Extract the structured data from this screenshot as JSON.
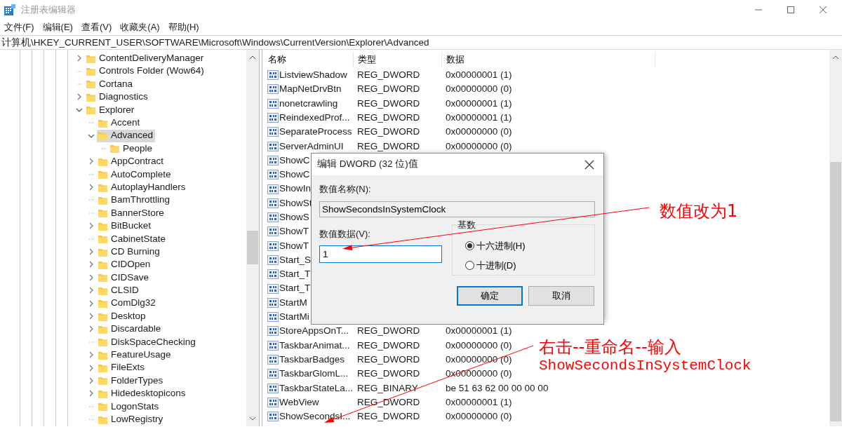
{
  "window": {
    "title": "注册表编辑器"
  },
  "menu": [
    "文件(F)",
    "编辑(E)",
    "查看(V)",
    "收藏夹(A)",
    "帮助(H)"
  ],
  "address": "计算机\\HKEY_CURRENT_USER\\SOFTWARE\\Microsoft\\Windows\\CurrentVersion\\Explorer\\Advanced",
  "tree": {
    "items": [
      {
        "label": "ContentDeliveryManager",
        "kind": "collapsed",
        "selected": false
      },
      {
        "label": "Controls Folder (Wow64)",
        "kind": "leaf",
        "selected": false
      },
      {
        "label": "Cortana",
        "kind": "leaf",
        "selected": false
      },
      {
        "label": "Diagnostics",
        "kind": "collapsed",
        "selected": false
      },
      {
        "label": "Explorer",
        "kind": "expanded",
        "selected": false,
        "children": [
          {
            "label": "Accent",
            "kind": "leaf",
            "selected": false
          },
          {
            "label": "Advanced",
            "kind": "expanded",
            "selected": true,
            "children": [
              {
                "label": "People",
                "kind": "leaf",
                "selected": false
              }
            ]
          },
          {
            "label": "AppContract",
            "kind": "collapsed",
            "selected": false
          },
          {
            "label": "AutoComplete",
            "kind": "leaf",
            "selected": false
          },
          {
            "label": "AutoplayHandlers",
            "kind": "collapsed",
            "selected": false
          },
          {
            "label": "BamThrottling",
            "kind": "leaf",
            "selected": false
          },
          {
            "label": "BannerStore",
            "kind": "leaf",
            "selected": false
          },
          {
            "label": "BitBucket",
            "kind": "collapsed",
            "selected": false
          },
          {
            "label": "CabinetState",
            "kind": "leaf",
            "selected": false
          },
          {
            "label": "CD Burning",
            "kind": "collapsed",
            "selected": false
          },
          {
            "label": "CIDOpen",
            "kind": "collapsed",
            "selected": false
          },
          {
            "label": "CIDSave",
            "kind": "collapsed",
            "selected": false
          },
          {
            "label": "CLSID",
            "kind": "collapsed",
            "selected": false
          },
          {
            "label": "ComDlg32",
            "kind": "collapsed",
            "selected": false
          },
          {
            "label": "Desktop",
            "kind": "collapsed",
            "selected": false
          },
          {
            "label": "Discardable",
            "kind": "collapsed",
            "selected": false
          },
          {
            "label": "DiskSpaceChecking",
            "kind": "leaf",
            "selected": false
          },
          {
            "label": "FeatureUsage",
            "kind": "collapsed",
            "selected": false
          },
          {
            "label": "FileExts",
            "kind": "collapsed",
            "selected": false
          },
          {
            "label": "FolderTypes",
            "kind": "collapsed",
            "selected": false
          },
          {
            "label": "Hidedesktopicons",
            "kind": "collapsed",
            "selected": false
          },
          {
            "label": "LogonStats",
            "kind": "leaf",
            "selected": false
          },
          {
            "label": "LowRegistry",
            "kind": "leaf",
            "selected": false
          }
        ]
      }
    ]
  },
  "values": {
    "columns": [
      "名称",
      "类型",
      "数据"
    ],
    "rows": [
      {
        "name": "ListviewShadow",
        "type": "REG_DWORD",
        "data": "0x00000001 (1)"
      },
      {
        "name": "MapNetDrvBtn",
        "type": "REG_DWORD",
        "data": "0x00000000 (0)"
      },
      {
        "name": "nonetcrawling",
        "type": "REG_DWORD",
        "data": "0x00000001 (1)"
      },
      {
        "name": "ReindexedProf...",
        "type": "REG_DWORD",
        "data": "0x00000001 (1)"
      },
      {
        "name": "SeparateProcess",
        "type": "REG_DWORD",
        "data": "0x00000000 (0)"
      },
      {
        "name": "ServerAdminUI",
        "type": "REG_DWORD",
        "data": "0x00000000 (0)"
      },
      {
        "name": "ShowC"
      },
      {
        "name": "ShowC"
      },
      {
        "name": "ShowIn"
      },
      {
        "name": "ShowSt"
      },
      {
        "name": "ShowS"
      },
      {
        "name": "ShowT"
      },
      {
        "name": "ShowT"
      },
      {
        "name": "Start_S"
      },
      {
        "name": "Start_T"
      },
      {
        "name": "Start_T"
      },
      {
        "name": "StartM"
      },
      {
        "name": "StartMi"
      },
      {
        "name": "StoreAppsOnT...",
        "type": "REG_DWORD",
        "data": "0x00000001 (1)"
      },
      {
        "name": "TaskbarAnimat...",
        "type": "REG_DWORD",
        "data": "0x00000000 (0)"
      },
      {
        "name": "TaskbarBadges",
        "type": "REG_DWORD",
        "data": "0x00000000 (0)"
      },
      {
        "name": "TaskbarGlomL...",
        "type": "REG_DWORD",
        "data": "0x00000000 (0)"
      },
      {
        "name": "TaskbarStateLa...",
        "type": "REG_BINARY",
        "data": "be 51 63 62 00 00 00 00"
      },
      {
        "name": "WebView",
        "type": "REG_DWORD",
        "data": "0x00000001 (1)"
      },
      {
        "name": "ShowSecondsI...",
        "type": "REG_DWORD",
        "data": "0x00000000 (0)"
      }
    ]
  },
  "dialog": {
    "title": "编辑 DWORD (32 位)值",
    "name_label": "数值名称(N):",
    "name_value": "ShowSecondsInSystemClock",
    "data_label": "数值数据(V):",
    "data_value": "1",
    "base_label": "基数",
    "radios": [
      {
        "label": "十六进制(H)",
        "selected": true
      },
      {
        "label": "十进制(D)",
        "selected": false
      }
    ],
    "buttons": [
      {
        "label": "确定",
        "default": true
      },
      {
        "label": "取消",
        "default": false
      }
    ]
  },
  "annotations": [
    {
      "lines": [
        {
          "text": "数值改为1",
          "kind": "caption"
        }
      ]
    },
    {
      "lines": [
        {
          "text": "右击--重命名--输入",
          "kind": "caption"
        },
        {
          "text": "ShowSecondsInSystemClock",
          "kind": "code"
        }
      ]
    }
  ]
}
